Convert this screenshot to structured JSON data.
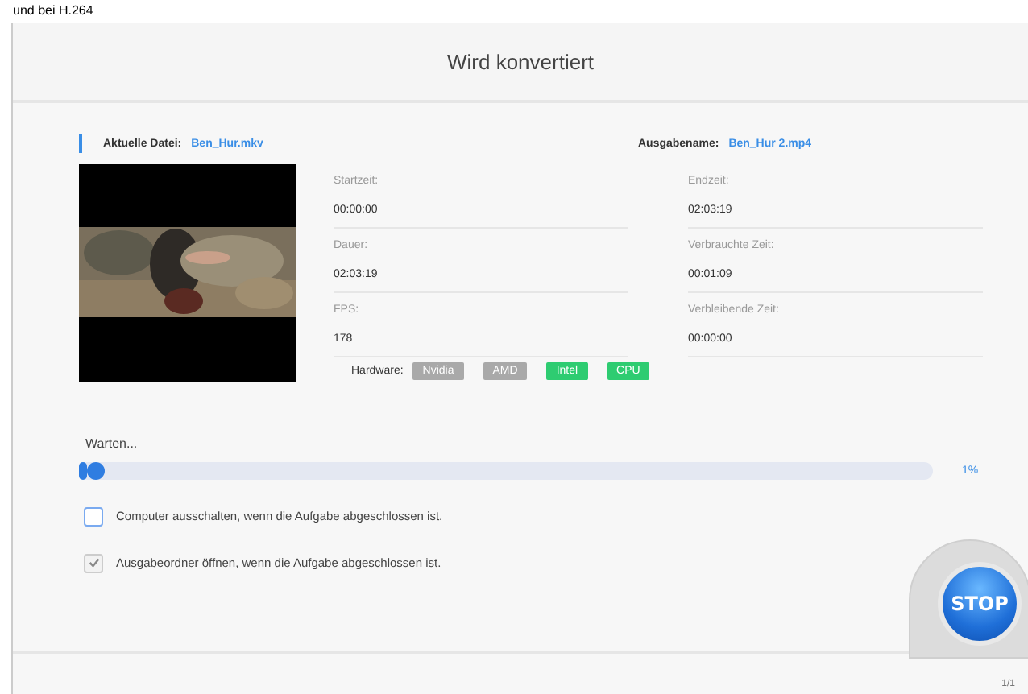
{
  "page_text": "und bei H.264",
  "window": {
    "title": "Wird konvertiert"
  },
  "current_file": {
    "label": "Aktuelle Datei:",
    "value": "Ben_Hur.mkv"
  },
  "output_name": {
    "label": "Ausgabename:",
    "value": "Ben_Hur 2.mp4"
  },
  "info_left": [
    {
      "label": "Startzeit:",
      "value": "00:00:00"
    },
    {
      "label": "Dauer:",
      "value": "02:03:19"
    },
    {
      "label": "FPS:",
      "value": "178"
    }
  ],
  "info_right": [
    {
      "label": "Endzeit:",
      "value": "02:03:19"
    },
    {
      "label": "Verbrauchte Zeit:",
      "value": "00:01:09"
    },
    {
      "label": "Verbleibende Zeit:",
      "value": "00:00:00"
    }
  ],
  "hardware": {
    "label": "Hardware:",
    "items": [
      {
        "label": "Nvidia",
        "enabled": false
      },
      {
        "label": "AMD",
        "enabled": false
      },
      {
        "label": "Intel",
        "enabled": true
      },
      {
        "label": "CPU",
        "enabled": true
      }
    ]
  },
  "progress": {
    "status": "Warten...",
    "level": 0.01,
    "percent": "1%"
  },
  "options": [
    {
      "label": "Computer ausschalten, wenn die Aufgabe abgeschlossen ist.",
      "checked": false
    },
    {
      "label": "Ausgabeordner öffnen, wenn die Aufgabe abgeschlossen ist.",
      "checked": true
    }
  ],
  "stop_button": {
    "label": "STOP"
  },
  "page_counter": "1/1"
}
